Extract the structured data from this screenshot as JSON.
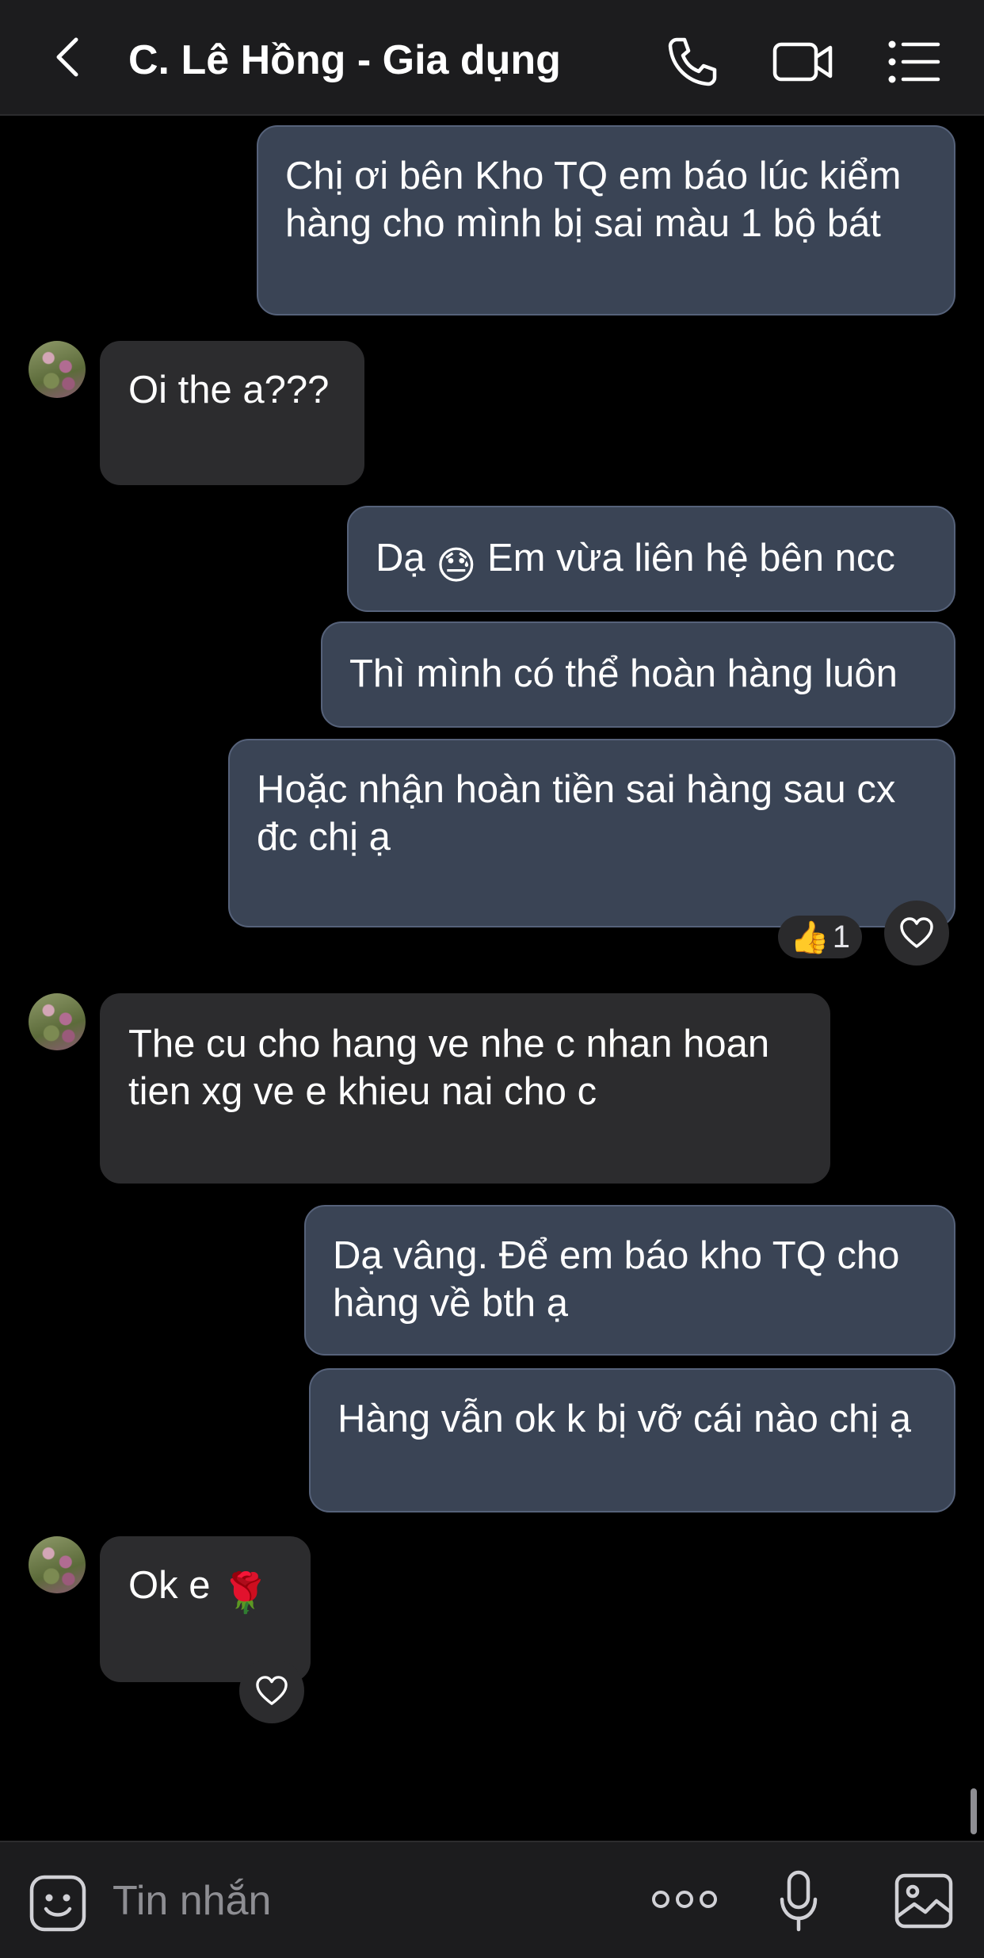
{
  "header": {
    "title": "C. Lê Hồng - Gia dụng",
    "back_icon": "chevron-left-icon",
    "call_icon": "phone-icon",
    "video_icon": "video-camera-icon",
    "menu_icon": "list-icon"
  },
  "messages": [
    {
      "direction": "out",
      "text": "Chị ơi bên Kho TQ em báo lúc kiểm hàng cho mình bị sai màu 1 bộ bát"
    },
    {
      "direction": "in",
      "text": "Oi the a???"
    },
    {
      "direction": "out",
      "text_before": "Dạ",
      "emoji": "😓",
      "text_after": "Em vừa liên hệ bên ncc"
    },
    {
      "direction": "out",
      "text": "Thì mình có thể hoàn hàng luôn"
    },
    {
      "direction": "out",
      "text": "Hoặc nhận hoàn tiền sai hàng sau cx đc chị ạ",
      "reaction": {
        "emoji": "👍",
        "count": "1"
      }
    },
    {
      "direction": "in",
      "text": "The cu cho hang ve nhe c nhan hoan tien xg ve e khieu nai cho c"
    },
    {
      "direction": "out",
      "text": "Dạ vâng. Để em báo kho TQ cho hàng về bth ạ"
    },
    {
      "direction": "out",
      "text": "Hàng vẫn ok k bị vỡ cái nào chị ạ"
    },
    {
      "direction": "in",
      "text": "Ok e",
      "emoji": "🌹"
    }
  ],
  "composer": {
    "placeholder": "Tin nhắn",
    "sticker_icon": "sticker-icon",
    "more_icon": "more-dots-icon",
    "mic_icon": "microphone-icon",
    "image_icon": "image-icon"
  },
  "colors": {
    "outgoing_bubble": "#3a4455",
    "incoming_bubble": "#2c2c2e",
    "background": "#000000",
    "bar_background": "#1c1c1e"
  }
}
